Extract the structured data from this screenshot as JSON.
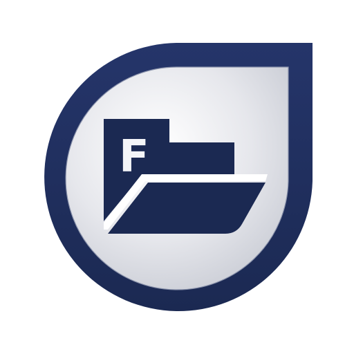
{
  "icon": {
    "name": "file-manager-app-icon",
    "glyph": "folder-icon",
    "letter": "F"
  },
  "colors": {
    "ring": "#1b2952",
    "ring_edge": "#25356a",
    "folder": "#1b2952",
    "background_light": "#ffffff",
    "background_mid": "#e6e7ec",
    "background_dark": "#c6c9d2",
    "highlight": "#ffffff"
  }
}
